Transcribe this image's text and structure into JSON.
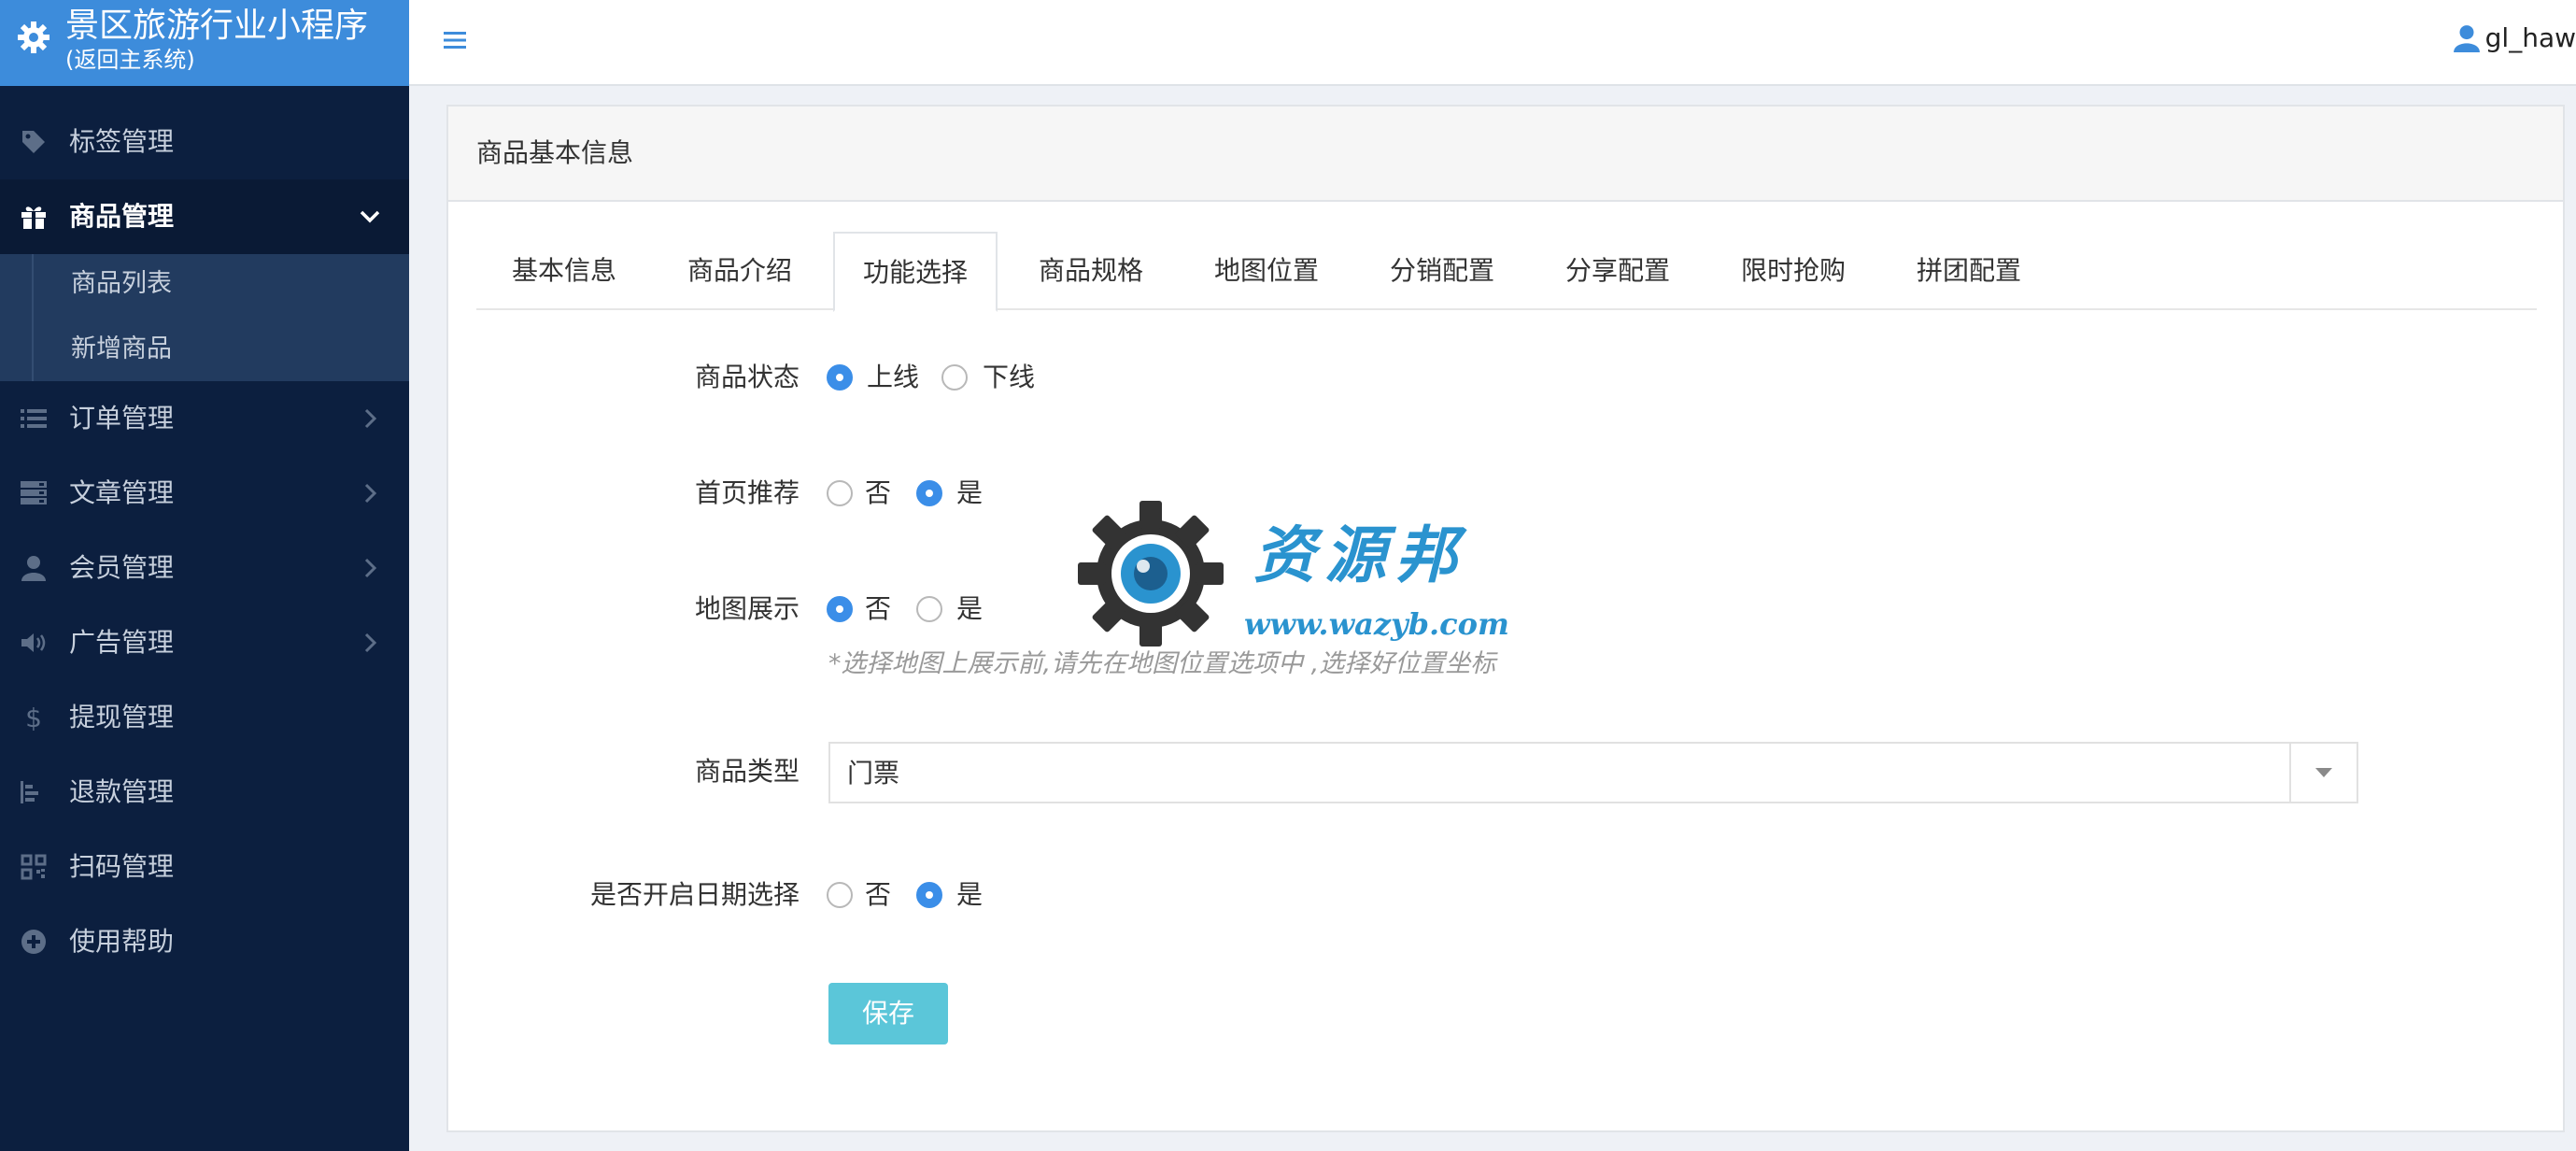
{
  "brand": {
    "title": "景区旅游行业小程序",
    "subtitle": "(返回主系统)",
    "icon": "gear-icon",
    "background": "#3d8cdb"
  },
  "sidebar": {
    "items": [
      {
        "label": "标签管理",
        "icon": "tag-icon"
      },
      {
        "label": "商品管理",
        "icon": "gift-icon",
        "expanded": true
      },
      {
        "label": "订单管理",
        "icon": "list-icon"
      },
      {
        "label": "文章管理",
        "icon": "server-icon"
      },
      {
        "label": "会员管理",
        "icon": "user-icon"
      },
      {
        "label": "广告管理",
        "icon": "volume-icon"
      },
      {
        "label": "提现管理",
        "icon": "dollar-icon"
      },
      {
        "label": "退款管理",
        "icon": "bar-chart-icon"
      },
      {
        "label": "扫码管理",
        "icon": "qrcode-icon"
      },
      {
        "label": "使用帮助",
        "icon": "plus-circle-icon"
      }
    ],
    "submenu": [
      {
        "label": "商品列表"
      },
      {
        "label": "新增商品"
      }
    ]
  },
  "topbar": {
    "username": "gl_haw",
    "menu_icon": "bars-icon",
    "user_icon": "user-icon"
  },
  "panel": {
    "title": "商品基本信息",
    "tabs": [
      {
        "label": "基本信息"
      },
      {
        "label": "商品介绍"
      },
      {
        "label": "功能选择",
        "active": true
      },
      {
        "label": "商品规格"
      },
      {
        "label": "地图位置"
      },
      {
        "label": "分销配置"
      },
      {
        "label": "分享配置"
      },
      {
        "label": "限时抢购"
      },
      {
        "label": "拼团配置"
      }
    ]
  },
  "form": {
    "status": {
      "label": "商品状态",
      "options": [
        "上线",
        "下线"
      ],
      "selected": "上线"
    },
    "home_recommend": {
      "label": "首页推荐",
      "options": [
        "否",
        "是"
      ],
      "selected": "是"
    },
    "map_display": {
      "label": "地图展示",
      "options": [
        "否",
        "是"
      ],
      "selected": "否",
      "hint": "*选择地图上展示前,请先在地图位置选项中 ,选择好位置坐标"
    },
    "product_type": {
      "label": "商品类型",
      "value": "门票"
    },
    "date_select": {
      "label": "是否开启日期选择",
      "options": [
        "否",
        "是"
      ],
      "selected": "是"
    },
    "save_label": "保存"
  },
  "watermark": {
    "text": "资源邦",
    "url": "www.wazyb.com"
  },
  "colors": {
    "sidebar_bg": "#0c1f3f",
    "accent": "#3b8ee8",
    "save_button": "#5bc6d9"
  }
}
